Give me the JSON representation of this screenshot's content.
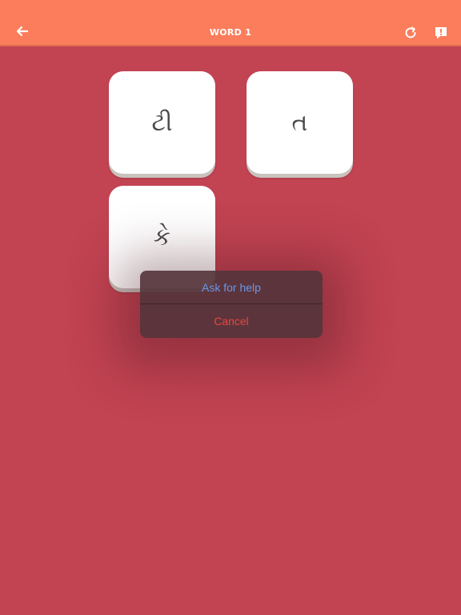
{
  "header": {
    "title": "WORD 1",
    "back_icon": "back-arrow-icon",
    "refresh_icon": "refresh-icon",
    "help_icon": "help-speech-bubble-icon"
  },
  "tiles": [
    {
      "letter": "ટી"
    },
    {
      "letter": "ત"
    },
    {
      "letter": "કે"
    }
  ],
  "action_sheet": {
    "help_label": "Ask for help",
    "cancel_label": "Cancel"
  },
  "colors": {
    "header_background": "#fb7d5b",
    "page_background": "#c24352",
    "tile_background": "#ffffff",
    "help_text": "#6b97e8",
    "cancel_text": "#e8473e"
  }
}
